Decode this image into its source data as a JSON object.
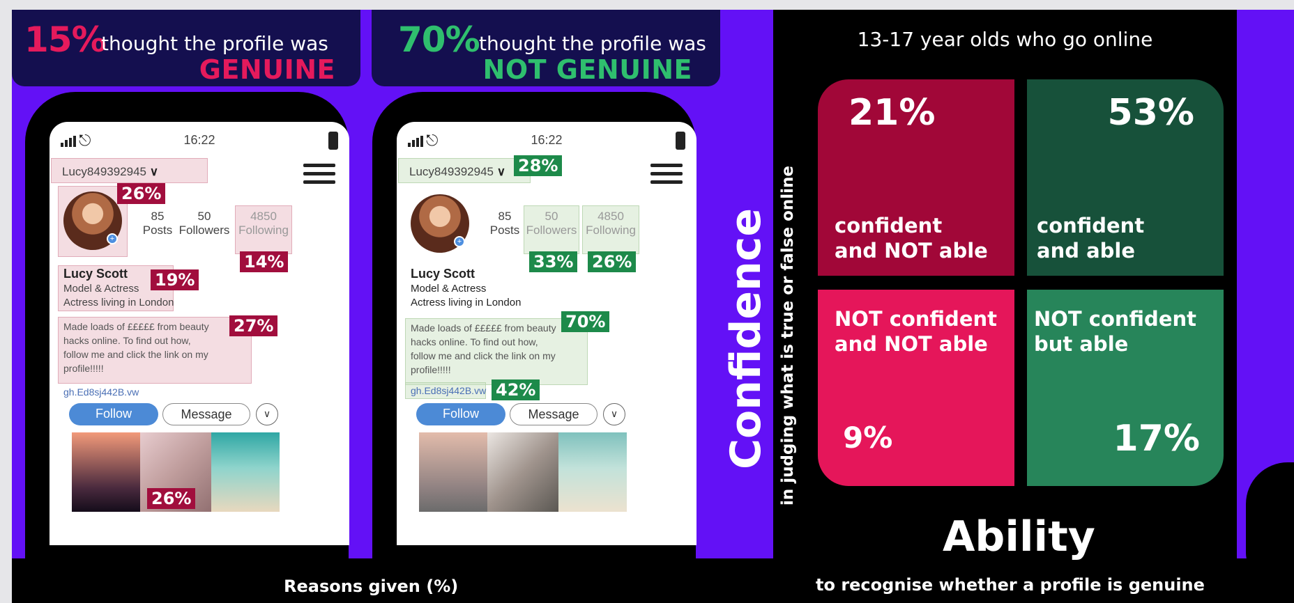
{
  "left_banner": {
    "pct": "15%",
    "text": "thought the profile was",
    "verdict": "GENUINE"
  },
  "right_banner": {
    "pct": "70%",
    "text": "thought the profile was",
    "verdict": "NOT GENUINE"
  },
  "profile": {
    "time": "16:22",
    "username": "Lucy849392945",
    "posts_count": "85",
    "posts_label": "Posts",
    "followers_count": "50",
    "followers_label": "Followers",
    "following_count": "4850",
    "following_label": "Following",
    "name": "Lucy Scott",
    "bio_line1": "Model & Actress",
    "bio_line2": "Actress living in London",
    "post_line1": "Made loads of £££££ from beauty",
    "post_line2": "hacks online. To find out how,",
    "post_line3": "follow me and click the link on my",
    "post_line4": "profile!!!!!",
    "link": "gh.Ed8sj442B.vw",
    "follow_label": "Follow",
    "message_label": "Message"
  },
  "genuine_reasons": {
    "avatar": "26%",
    "following": "14%",
    "bio": "19%",
    "post": "27%",
    "photos": "26%"
  },
  "not_genuine_reasons": {
    "username": "28%",
    "followers": "33%",
    "following": "26%",
    "post": "70%",
    "link": "42%"
  },
  "reasons_caption": "Reasons given (%)",
  "matrix": {
    "title": "13-17 year olds who go online",
    "y_axis_title": "Confidence",
    "y_axis_sub": "in judging what is true or false online",
    "x_axis_title": "Ability",
    "x_axis_sub": "to recognise whether a profile is genuine",
    "q1": {
      "value": "21%",
      "label1": "confident",
      "label2": "and NOT able",
      "color": "#a10738"
    },
    "q2": {
      "value": "53%",
      "label1": "confident",
      "label2": "and able",
      "color": "#17513a"
    },
    "q3": {
      "value": "9%",
      "label1": "NOT confident",
      "label2": "and NOT able",
      "color": "#e5165a"
    },
    "q4": {
      "value": "17%",
      "label1": "NOT confident",
      "label2": "but able",
      "color": "#27855a"
    }
  },
  "colors": {
    "background": "#6311f6",
    "banner": "#140f4f",
    "genuine_accent": "#e51a5c",
    "not_genuine_accent": "#2fbf6e"
  }
}
